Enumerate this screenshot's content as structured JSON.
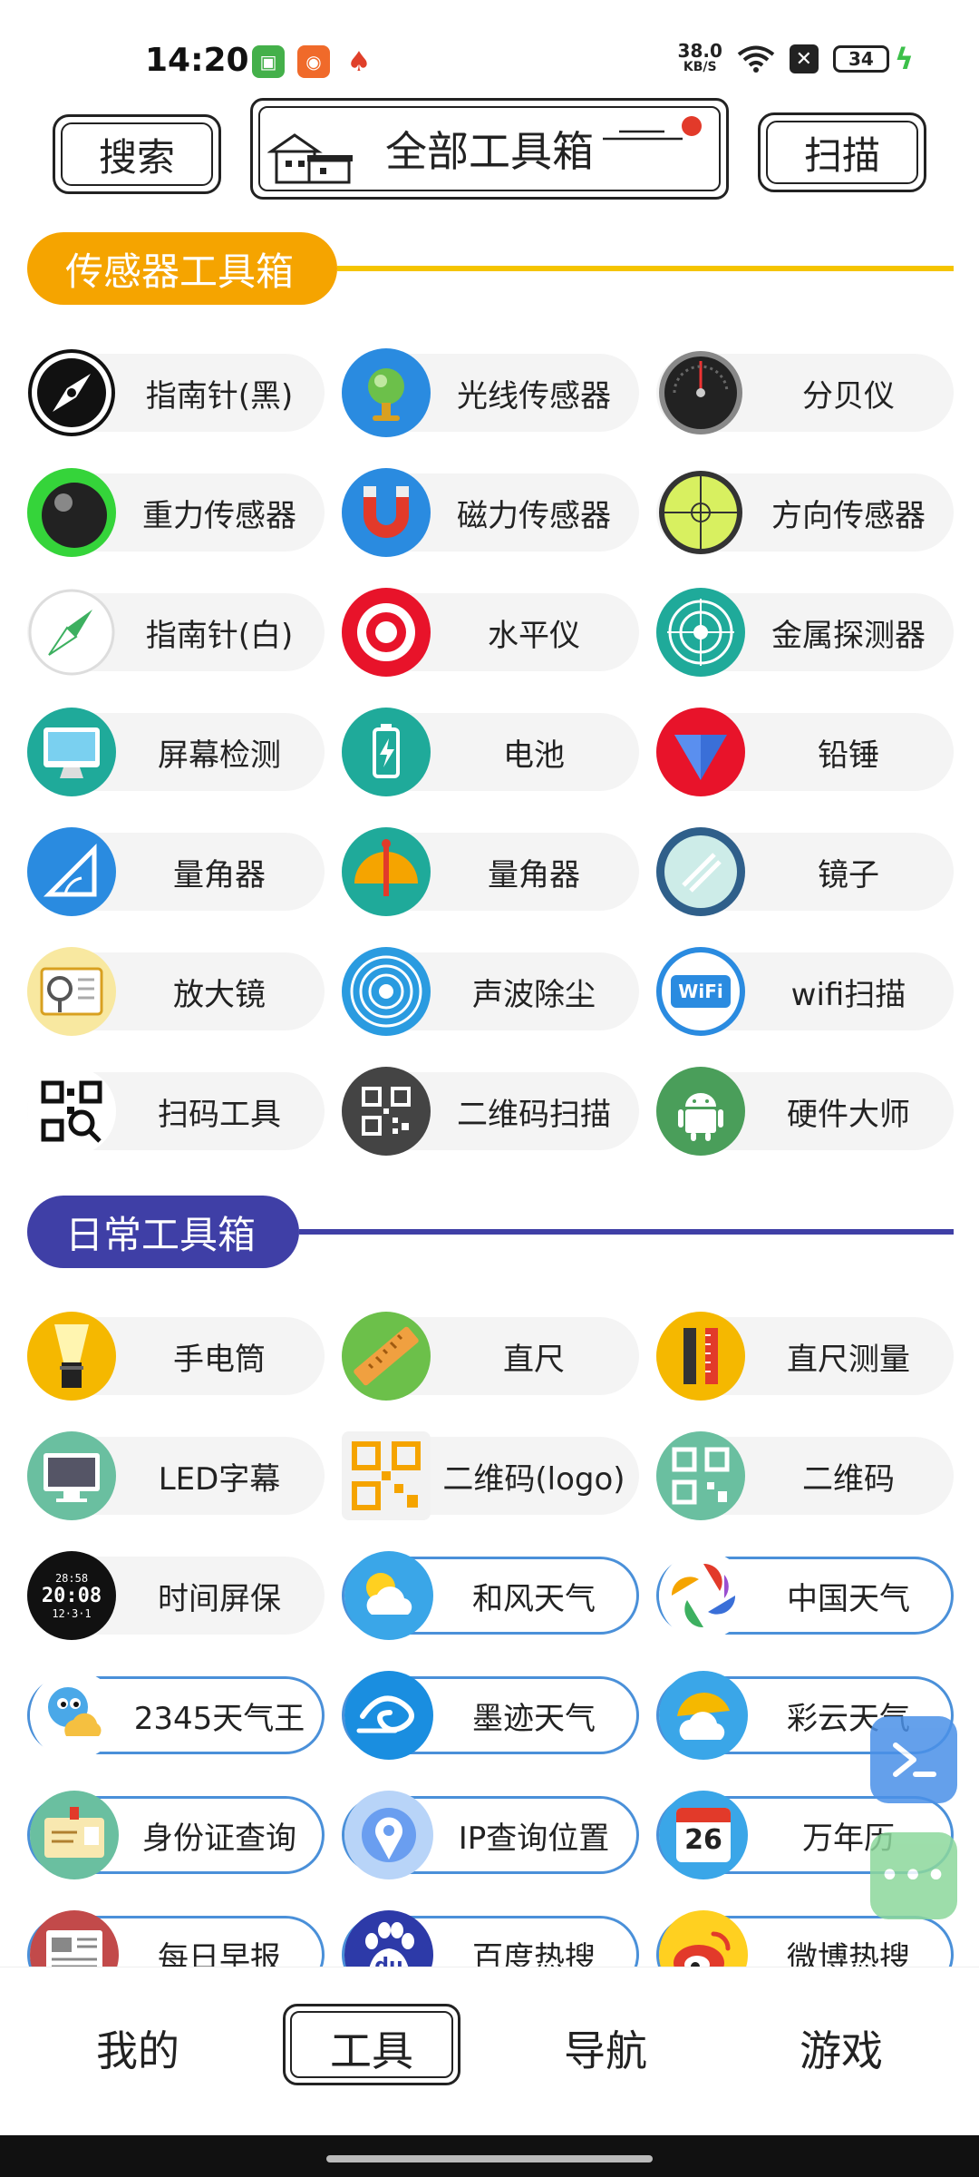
{
  "status_bar": {
    "time": "14:20",
    "net_speed_value": "38.0",
    "net_speed_unit": "KB/S",
    "battery": "34"
  },
  "header": {
    "search_label": "搜索",
    "title": "全部工具箱",
    "scan_label": "扫描"
  },
  "sensor_section": {
    "title": "传感器工具箱",
    "color": "#f5a400",
    "tools": [
      {
        "label": "指南针(黑)",
        "icon": "compass-black-icon"
      },
      {
        "label": "光线传感器",
        "icon": "light-sensor-icon"
      },
      {
        "label": "分贝仪",
        "icon": "decibel-meter-icon"
      },
      {
        "label": "重力传感器",
        "icon": "gravity-ball-icon"
      },
      {
        "label": "磁力传感器",
        "icon": "magnet-icon"
      },
      {
        "label": "方向传感器",
        "icon": "level-bubble-icon"
      },
      {
        "label": "指南针(白)",
        "icon": "compass-white-icon"
      },
      {
        "label": "水平仪",
        "icon": "target-icon"
      },
      {
        "label": "金属探测器",
        "icon": "radar-icon"
      },
      {
        "label": "屏幕检测",
        "icon": "monitor-icon"
      },
      {
        "label": "电池",
        "icon": "battery-icon"
      },
      {
        "label": "铅锤",
        "icon": "plumb-bob-icon"
      },
      {
        "label": "量角器",
        "icon": "protractor-icon"
      },
      {
        "label": "量角器",
        "icon": "protractor-compass-icon"
      },
      {
        "label": "镜子",
        "icon": "mirror-icon"
      },
      {
        "label": "放大镜",
        "icon": "magnifier-icon"
      },
      {
        "label": "声波除尘",
        "icon": "sound-wave-icon"
      },
      {
        "label": "wifi扫描",
        "icon": "wifi-icon"
      },
      {
        "label": "扫码工具",
        "icon": "scan-code-icon"
      },
      {
        "label": "二维码扫描",
        "icon": "qr-scan-icon"
      },
      {
        "label": "硬件大师",
        "icon": "android-icon"
      }
    ]
  },
  "daily_section": {
    "title": "日常工具箱",
    "color": "#3f3fa6",
    "tools": [
      {
        "label": "手电筒",
        "icon": "flashlight-icon",
        "outlined": false
      },
      {
        "label": "直尺",
        "icon": "ruler-icon",
        "outlined": false
      },
      {
        "label": "直尺测量",
        "icon": "ruler-measure-icon",
        "outlined": false
      },
      {
        "label": "LED字幕",
        "icon": "led-monitor-icon",
        "outlined": false
      },
      {
        "label": "二维码(logo)",
        "icon": "qr-logo-icon",
        "outlined": false
      },
      {
        "label": "二维码",
        "icon": "qr-code-icon",
        "outlined": false
      },
      {
        "label": "时间屏保",
        "icon": "clock-screen-icon",
        "outlined": false
      },
      {
        "label": "和风天气",
        "icon": "weather-sun-cloud-icon",
        "outlined": true
      },
      {
        "label": "中国天气",
        "icon": "china-weather-icon",
        "outlined": true
      },
      {
        "label": "2345天气王",
        "icon": "weather-bird-icon",
        "outlined": true
      },
      {
        "label": "墨迹天气",
        "icon": "moji-weather-icon",
        "outlined": true
      },
      {
        "label": "彩云天气",
        "icon": "caiyun-weather-icon",
        "outlined": true
      },
      {
        "label": "身份证查询",
        "icon": "id-card-icon",
        "outlined": true
      },
      {
        "label": "IP查询位置",
        "icon": "location-pin-icon",
        "outlined": true
      },
      {
        "label": "万年历",
        "icon": "calendar-icon",
        "outlined": true,
        "badge": "26"
      },
      {
        "label": "每日早报",
        "icon": "newspaper-icon",
        "outlined": true
      },
      {
        "label": "百度热搜",
        "icon": "baidu-icon",
        "outlined": true,
        "badge": "du"
      },
      {
        "label": "微博热搜",
        "icon": "weibo-icon",
        "outlined": true
      }
    ]
  },
  "clock_icon_texts": [
    "28:58",
    "20:08",
    "12·3·1"
  ],
  "wifi_icon_text": "WiFi",
  "nav": {
    "items": [
      "我的",
      "工具",
      "导航",
      "游戏"
    ],
    "active": "工具"
  }
}
